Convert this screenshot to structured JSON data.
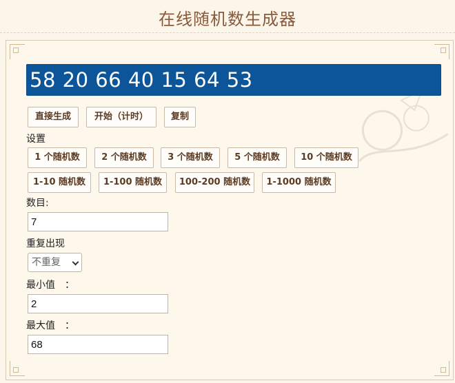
{
  "header": {
    "title": "在线随机数生成器"
  },
  "result": {
    "text": "58 20 66 40 15 64 53"
  },
  "actions": {
    "direct_generate": "直接生成",
    "start_timer": "开始（计时）",
    "copy": "复制"
  },
  "settings": {
    "label": "设置",
    "presets_count": [
      "1 个随机数",
      "2 个随机数",
      "3 个随机数",
      "5 个随机数",
      "10 个随机数"
    ],
    "presets_range": [
      "1-10 随机数",
      "1-100 随机数",
      "100-200 随机数",
      "1-1000 随机数"
    ]
  },
  "form": {
    "count_label": "数目:",
    "count_value": "7",
    "repeat_label": "重复出现",
    "repeat_selected": "不重复",
    "min_label": "最小值　：",
    "min_value": "2",
    "max_label": "最大值　：",
    "max_value": "68"
  },
  "colors": {
    "background": "#fbf5ea",
    "accent": "#0b5598",
    "title": "#8a5a3b"
  }
}
